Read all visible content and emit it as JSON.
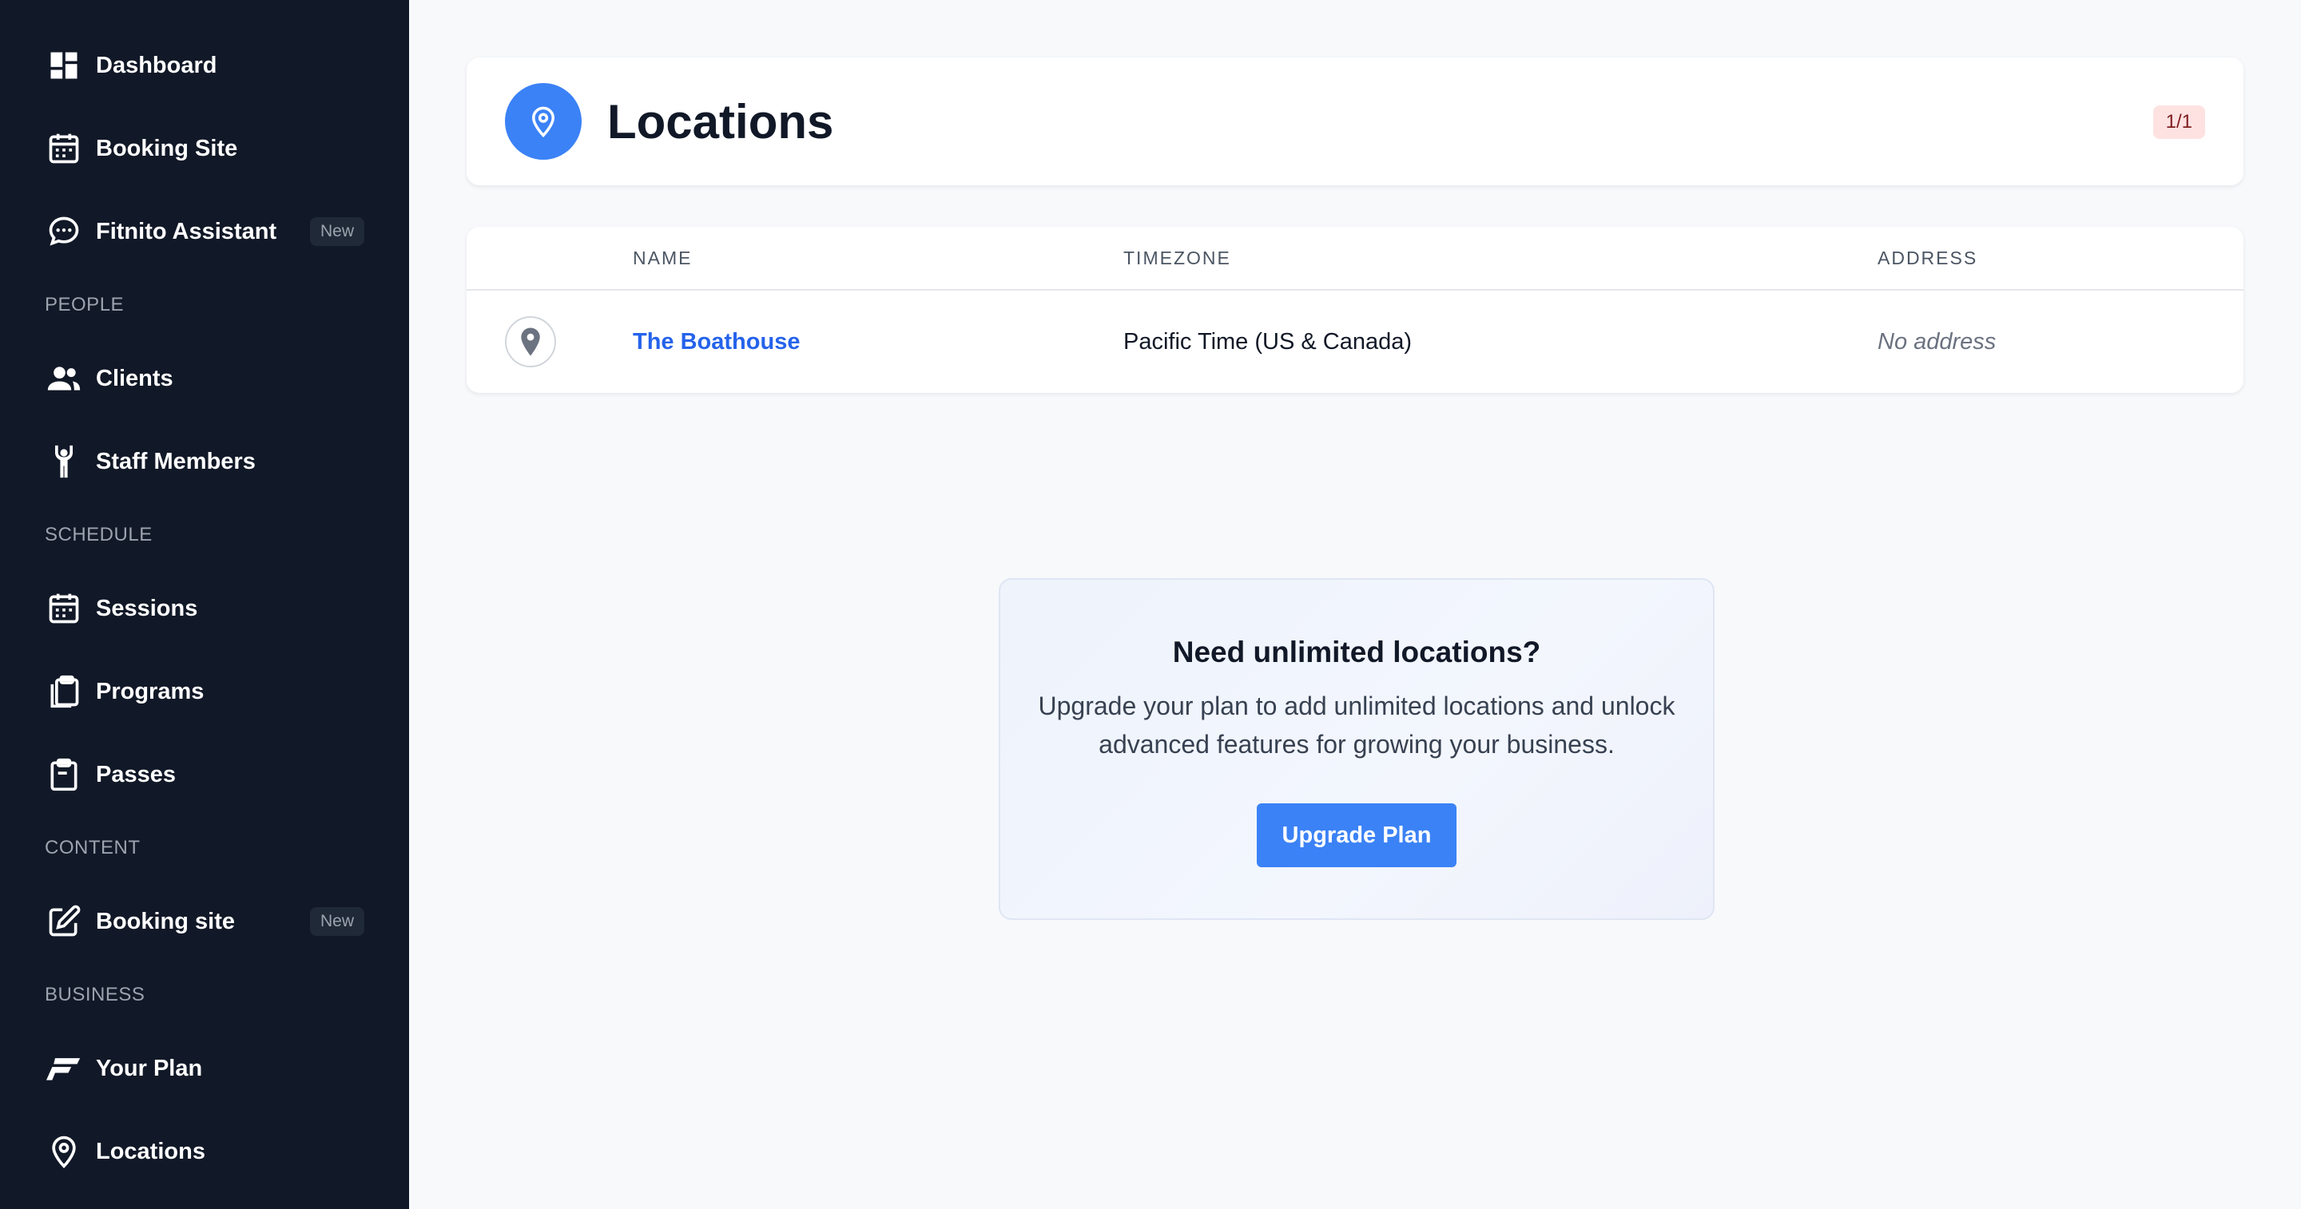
{
  "sidebar": {
    "top_items": [
      {
        "label": "Dashboard",
        "icon": "dashboard-icon"
      },
      {
        "label": "Booking Site",
        "icon": "calendar-icon"
      },
      {
        "label": "Fitnito Assistant",
        "icon": "chat-bubble-icon",
        "badge": "New"
      }
    ],
    "sections": [
      {
        "header": "PEOPLE",
        "items": [
          {
            "label": "Clients",
            "icon": "users-icon"
          },
          {
            "label": "Staff Members",
            "icon": "person-raised-arms-icon"
          }
        ]
      },
      {
        "header": "SCHEDULE",
        "items": [
          {
            "label": "Sessions",
            "icon": "calendar-icon"
          },
          {
            "label": "Programs",
            "icon": "clipboard-stack-icon"
          },
          {
            "label": "Passes",
            "icon": "clipboard-icon"
          }
        ]
      },
      {
        "header": "CONTENT",
        "items": [
          {
            "label": "Booking site",
            "icon": "edit-icon",
            "badge": "New"
          }
        ]
      },
      {
        "header": "BUSINESS",
        "items": [
          {
            "label": "Your Plan",
            "icon": "fitnito-logo-icon"
          },
          {
            "label": "Locations",
            "icon": "map-pin-icon"
          }
        ]
      }
    ]
  },
  "header": {
    "title": "Locations",
    "count": "1/1",
    "icon": "map-pin-icon"
  },
  "table": {
    "columns": [
      "NAME",
      "TIMEZONE",
      "ADDRESS"
    ],
    "rows": [
      {
        "name": "The Boathouse",
        "timezone": "Pacific Time (US & Canada)",
        "address": "No address"
      }
    ]
  },
  "upgrade": {
    "title": "Need unlimited locations?",
    "text": "Upgrade your plan to add unlimited locations and unlock advanced features for growing your business.",
    "button": "Upgrade Plan"
  },
  "colors": {
    "sidebar_bg": "#111827",
    "accent": "#3b82f6",
    "link": "#2563eb",
    "count_badge_bg": "#fee2e2"
  }
}
